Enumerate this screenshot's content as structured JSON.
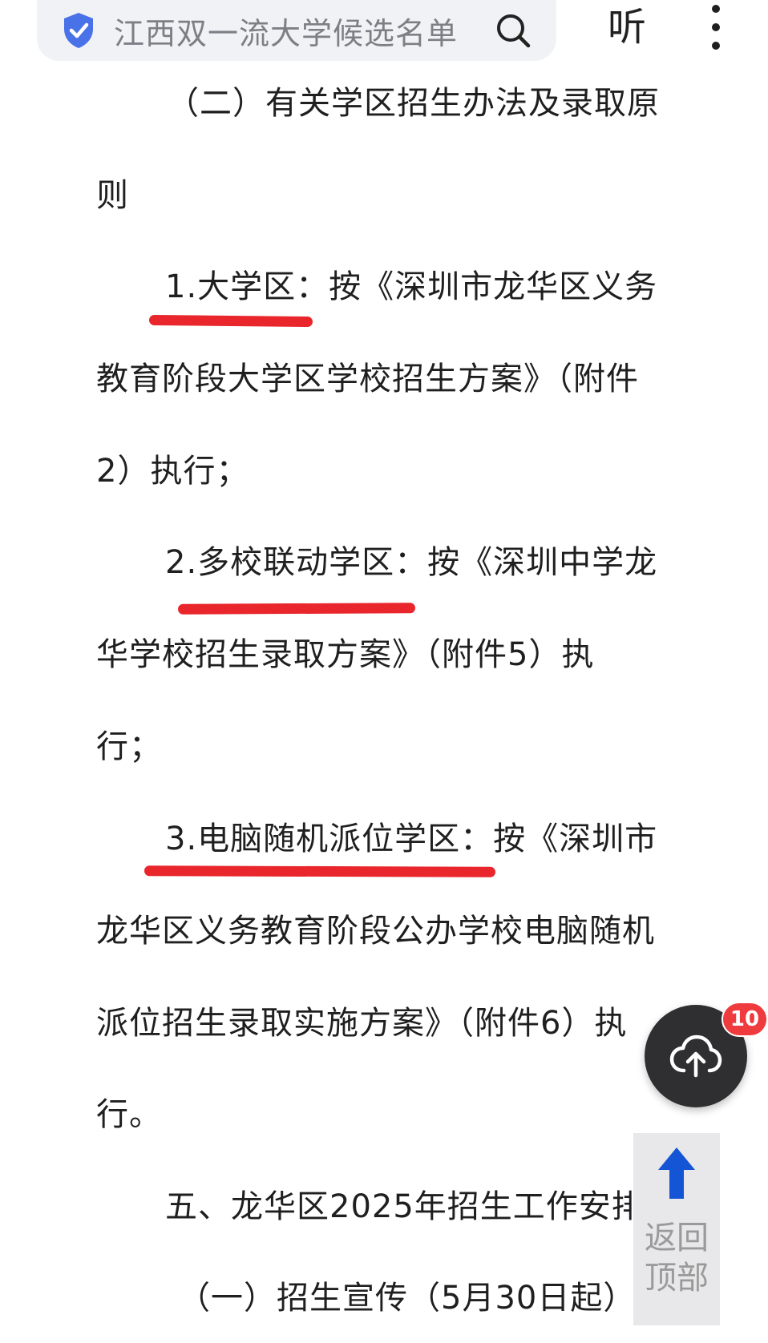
{
  "top_bar": {
    "search_text": "江西双一流大学候选名单",
    "listen_label": "听",
    "icons": {
      "shield": "verified-shield-icon",
      "search": "search-icon",
      "more": "more-vertical-icon"
    }
  },
  "article": {
    "lines": [
      "（二）有关学区招生办法及录取原",
      "则",
      "1.大学区：按《深圳市龙华区义务",
      "教育阶段大学区学校招生方案》（附件",
      "2）执行；",
      "2.多校联动学区：按《深圳中学龙",
      "华学校招生录取方案》（附件5）执",
      "行；",
      "3.电脑随机派位学区：按《深圳市",
      "龙华区义务教育阶段公办学校电脑随机",
      "派位招生录取实施方案》（附件6）执",
      "行。",
      "五、龙华区2025年招生工作安排",
      "（一）招生宣传（5月30日起）"
    ]
  },
  "floating": {
    "upload_badge": "10",
    "back_to_top_line1": "返回",
    "back_to_top_line2": "顶部"
  },
  "colors": {
    "underline": "#e8262b",
    "shield": "#4a72e8",
    "badge": "#ef3a3e",
    "arrow": "#1455d6"
  }
}
